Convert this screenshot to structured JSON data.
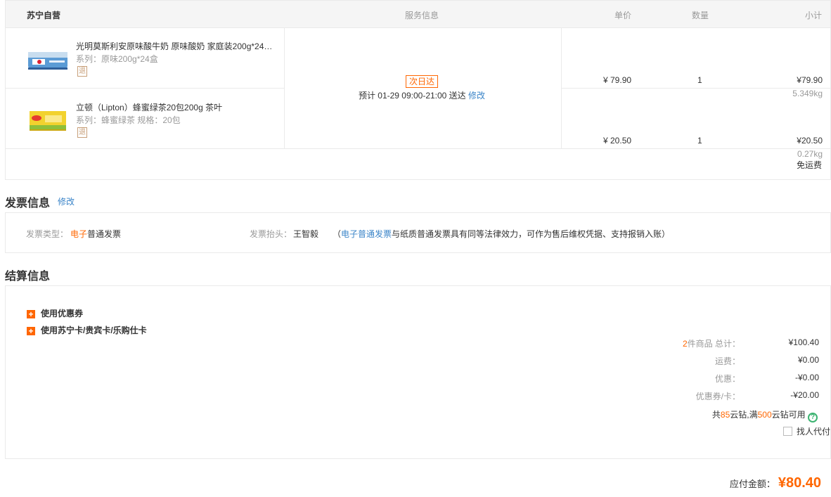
{
  "order_header": {
    "store": "苏宁自营",
    "service_col": "服务信息",
    "price_col": "单价",
    "qty_col": "数量",
    "subtotal_col": "小计"
  },
  "items": [
    {
      "title": "光明莫斯利安原味酸牛奶 原味酸奶 家庭装200g*24…",
      "spec": "系列：原味200g*24盒",
      "return_badge": "退",
      "price": "¥ 79.90",
      "qty": "1",
      "subtotal": "¥79.90",
      "weight": "5.349kg"
    },
    {
      "title": "立顿（Lipton）蜂蜜绿茶20包200g 茶叶",
      "spec": "系列：蜂蜜绿茶    规格：20包",
      "return_badge": "退",
      "price": "¥ 20.50",
      "qty": "1",
      "subtotal": "¥20.50",
      "weight": "0.27kg"
    }
  ],
  "service": {
    "badge": "次日达",
    "delivery_text": "预计 01-29 09:00-21:00 送达",
    "modify": "修改"
  },
  "freight": "免运费",
  "invoice": {
    "title": "发票信息",
    "modify": "修改",
    "type_label": "发票类型：",
    "type_value_highlight": "电子",
    "type_value_rest": "普通发票",
    "head_label": "发票抬头：",
    "head_value": "王智毅",
    "note_prefix": "（",
    "note_link": "电子普通发票",
    "note_rest": "与纸质普通发票具有同等法律效力，可作为售后维权凭据、支持报销入账）"
  },
  "settlement": {
    "title": "结算信息",
    "use_coupon": "使用优惠券",
    "use_card": "使用苏宁卡/贵宾卡/乐购仕卡",
    "rows": [
      {
        "label_highlight": "2",
        "label": "件商品 总计：",
        "value": "¥100.40"
      },
      {
        "label_highlight": "",
        "label": "运费：",
        "value": "¥0.00"
      },
      {
        "label_highlight": "",
        "label": "优惠：",
        "value": "-¥0.00"
      },
      {
        "label_highlight": "",
        "label": "优惠券/卡：",
        "value": "-¥20.00"
      }
    ],
    "points_prefix": "共",
    "points_count": "85",
    "points_mid": "云钻,满",
    "points_threshold": "500",
    "points_suffix": "云钻可用",
    "help_symbol": "?",
    "proxy_pay": "找人代付"
  },
  "payable": {
    "label": "应付金额：",
    "amount": "¥80.40"
  }
}
